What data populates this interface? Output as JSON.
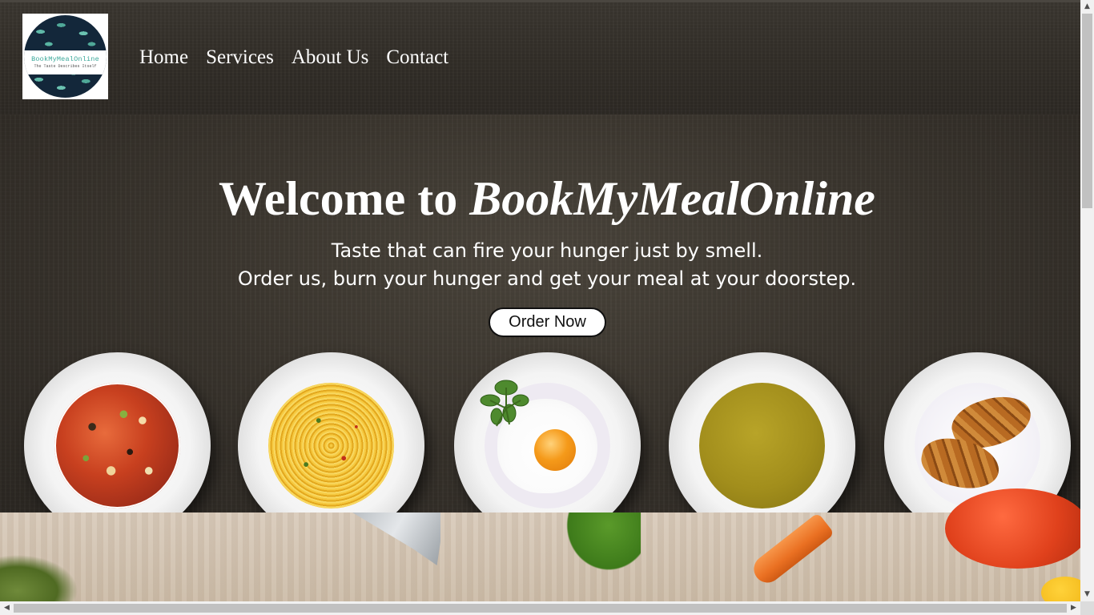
{
  "brand": {
    "logo_name": "BookMyMealOnline",
    "logo_tagline": "The Taste Describes Itself",
    "logo_icon": "leaf-pattern-logo"
  },
  "nav": {
    "items": [
      {
        "label": "Home"
      },
      {
        "label": "Services"
      },
      {
        "label": "About Us"
      },
      {
        "label": "Contact"
      }
    ]
  },
  "hero": {
    "title_prefix": "Welcome to ",
    "title_brand": "BookMyMealOnline",
    "tagline_line1": "Taste that can fire your hunger just by smell.",
    "tagline_line2": "Order us, burn your hunger and get your meal at your doorstep.",
    "cta_label": "Order Now"
  },
  "dishes": [
    {
      "icon": "vegetable-soup-plate-icon"
    },
    {
      "icon": "spaghetti-plate-icon"
    },
    {
      "icon": "fried-egg-plate-icon"
    },
    {
      "icon": "lentil-soup-plate-icon"
    },
    {
      "icon": "croissant-plate-icon"
    }
  ],
  "colors": {
    "background": "#3a352e",
    "text": "#ffffff",
    "button_bg": "#ffffff",
    "button_border": "#111111",
    "logo_accent": "#3aa89a",
    "logo_dark": "#13273a"
  }
}
